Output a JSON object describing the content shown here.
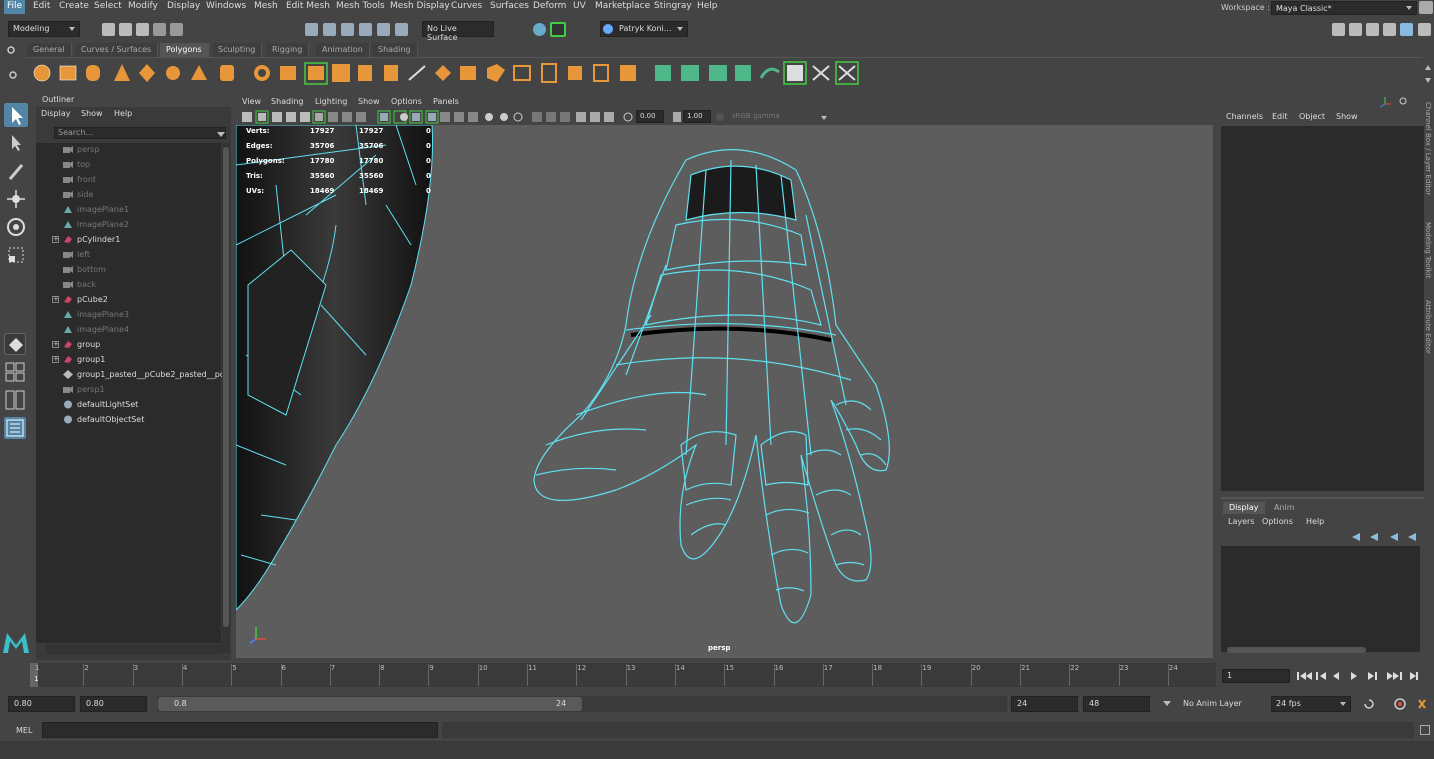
{
  "menu": {
    "items": [
      "File",
      "Edit",
      "Create",
      "Select",
      "Modify",
      "Display",
      "Windows",
      "Mesh",
      "Edit Mesh",
      "Mesh Tools",
      "Mesh Display",
      "Curves",
      "Surfaces",
      "Deform",
      "UV",
      "Marketplace",
      "Stingray",
      "Help"
    ],
    "workspace_label": "Workspace :",
    "workspace_value": "Maya Classic*"
  },
  "status": {
    "mode": "Modeling",
    "live_surface": "No Live Surface",
    "user": "Patryk Koni..."
  },
  "shelf": {
    "tabs": [
      "General",
      "Curves / Surfaces",
      "Polygons",
      "Sculpting",
      "Rigging",
      "Animation",
      "Shading"
    ],
    "active_tab": "Polygons"
  },
  "outliner": {
    "title": "Outliner",
    "menu": [
      "Display",
      "Show",
      "Help"
    ],
    "search_placeholder": "Search...",
    "items": [
      {
        "label": "persp",
        "dim": true,
        "expand": false,
        "icon": "camera"
      },
      {
        "label": "top",
        "dim": true,
        "expand": false,
        "icon": "camera"
      },
      {
        "label": "front",
        "dim": true,
        "expand": false,
        "icon": "camera"
      },
      {
        "label": "side",
        "dim": true,
        "expand": false,
        "icon": "camera"
      },
      {
        "label": "imagePlane1",
        "dim": true,
        "expand": false,
        "icon": "imageplane"
      },
      {
        "label": "imagePlane2",
        "dim": true,
        "expand": false,
        "icon": "imageplane"
      },
      {
        "label": "pCylinder1",
        "dim": false,
        "expand": true,
        "icon": "mesh"
      },
      {
        "label": "left",
        "dim": true,
        "expand": false,
        "icon": "camera"
      },
      {
        "label": "bottom",
        "dim": true,
        "expand": false,
        "icon": "camera"
      },
      {
        "label": "back",
        "dim": true,
        "expand": false,
        "icon": "camera"
      },
      {
        "label": "pCube2",
        "dim": false,
        "expand": true,
        "icon": "mesh"
      },
      {
        "label": "imagePlane3",
        "dim": true,
        "expand": false,
        "icon": "imageplane"
      },
      {
        "label": "imagePlane4",
        "dim": true,
        "expand": false,
        "icon": "imageplane"
      },
      {
        "label": "group",
        "dim": false,
        "expand": true,
        "icon": "mesh"
      },
      {
        "label": "group1",
        "dim": false,
        "expand": true,
        "icon": "mesh"
      },
      {
        "label": "group1_pasted__pCube2_pasted__pc",
        "dim": false,
        "expand": false,
        "icon": "transform"
      },
      {
        "label": "persp1",
        "dim": true,
        "expand": false,
        "icon": "camera"
      },
      {
        "label": "defaultLightSet",
        "dim": false,
        "expand": false,
        "icon": "set"
      },
      {
        "label": "defaultObjectSet",
        "dim": false,
        "expand": false,
        "icon": "set"
      }
    ]
  },
  "viewport": {
    "menu": [
      "View",
      "Shading",
      "Lighting",
      "Show",
      "Options",
      "Panels"
    ],
    "exposure": "0.00",
    "gamma": "1.00",
    "colorspace": "sRGB gamma",
    "camera_label": "persp",
    "hud": {
      "rows": [
        {
          "label": "Verts:",
          "a": "17927",
          "b": "17927",
          "c": "0"
        },
        {
          "label": "Edges:",
          "a": "35706",
          "b": "35706",
          "c": "0"
        },
        {
          "label": "Polygons:",
          "a": "17780",
          "b": "17780",
          "c": "0"
        },
        {
          "label": "Tris:",
          "a": "35560",
          "b": "35560",
          "c": "0"
        },
        {
          "label": "UVs:",
          "a": "18469",
          "b": "18469",
          "c": "0"
        }
      ]
    }
  },
  "channelbox": {
    "menu": [
      "Channels",
      "Edit",
      "Object",
      "Show"
    ],
    "side_tabs": [
      "Channel Box / Layer Editor",
      "Modeling Toolkit",
      "Attribute Editor"
    ]
  },
  "layer_editor": {
    "tabs": [
      "Display",
      "Anim"
    ],
    "menu": [
      "Layers",
      "Options",
      "Help"
    ]
  },
  "timeline": {
    "ticks": [
      "1",
      "2",
      "3",
      "4",
      "5",
      "6",
      "7",
      "8",
      "9",
      "10",
      "11",
      "12",
      "13",
      "14",
      "15",
      "16",
      "17",
      "18",
      "19",
      "20",
      "21",
      "22",
      "23",
      "24"
    ],
    "current_frame_marker": "1",
    "current_frame": "1"
  },
  "range": {
    "start": "0.80",
    "anim_start": "0.80",
    "slider_start": "0.8",
    "slider_end": "24",
    "anim_end": "24",
    "end": "48",
    "anim_layer": "No Anim Layer",
    "fps": "24 fps"
  },
  "command": {
    "lang": "MEL"
  },
  "colors": {
    "accent": "#5285a6",
    "wire": "#5fe0f0",
    "viewport_bg": "#5d5d5d",
    "shelf_orange": "#e8963a",
    "shelf_green": "#4fb88a"
  }
}
